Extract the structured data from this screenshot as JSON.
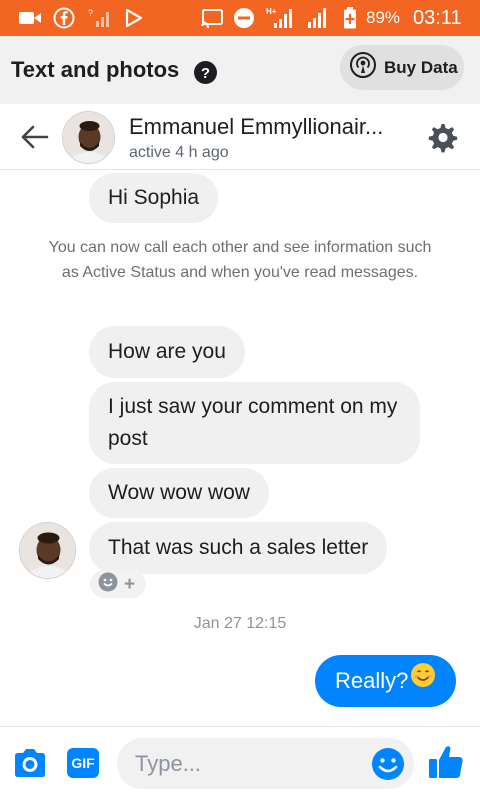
{
  "status_bar": {
    "network_label": "H+",
    "battery_percent": "89%",
    "time": "03:11",
    "icons": [
      "video-icon",
      "facebook-icon",
      "signal-icon",
      "play-icon",
      "cast-icon",
      "do-not-disturb-icon",
      "signal-icon",
      "signal-icon",
      "battery-icon"
    ]
  },
  "app_header": {
    "title": "Text and photos",
    "buy_data_label": "Buy Data"
  },
  "conversation_header": {
    "contact_name": "Emmanuel Emmyllionair...",
    "active_status": "active 4 h ago"
  },
  "messages": {
    "greeting": "Hi Sophia",
    "system_note": "You can now call each other and see information such as Active Status and when you've read messages.",
    "incoming": [
      "How are you",
      "I just saw your comment on my post",
      "Wow wow wow",
      "That was such a sales letter"
    ],
    "timestamp": "Jan 27 12:15",
    "outgoing": {
      "text": "Really?",
      "emoji": "😊"
    }
  },
  "composer": {
    "placeholder": "Type...",
    "gif_label": "GIF"
  },
  "colors": {
    "status_bar": "#f26522",
    "messenger_blue": "#0084ff",
    "bubble_gray": "#f1f0f0"
  }
}
